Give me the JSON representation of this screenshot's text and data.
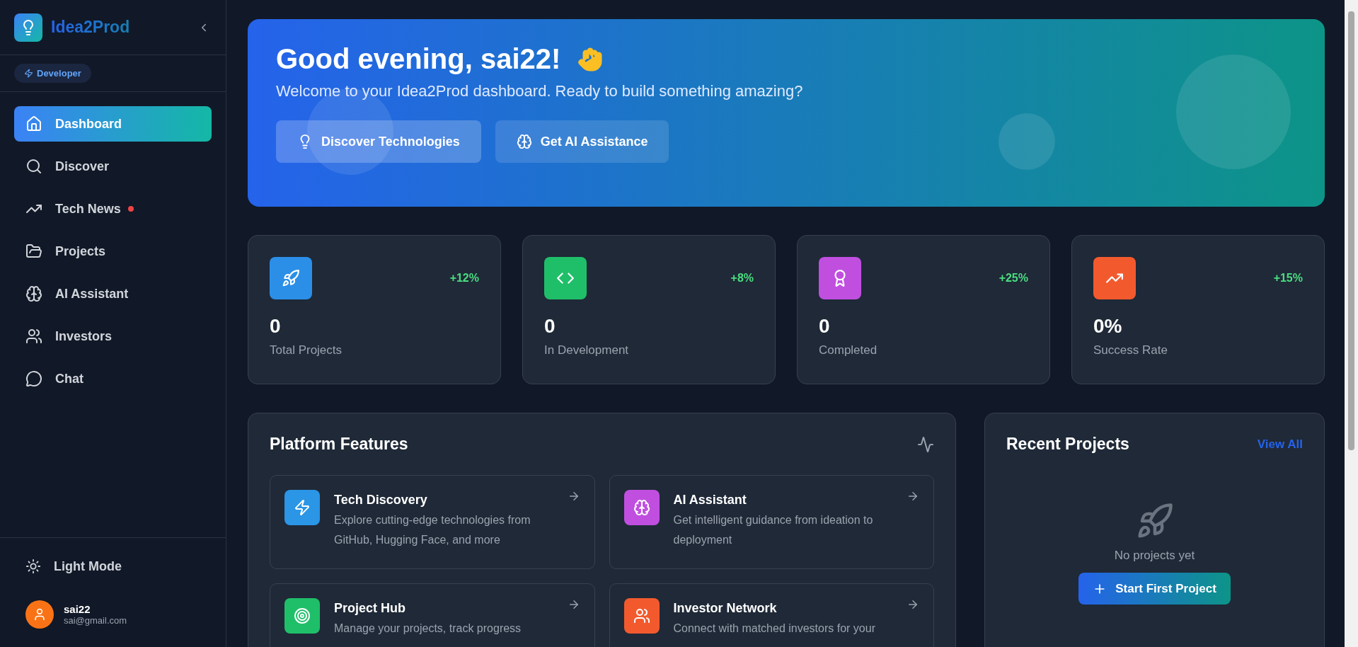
{
  "sidebar": {
    "logo": "Idea2Prod",
    "role_badge": "Developer",
    "items": [
      {
        "label": "Dashboard",
        "selected": true,
        "notification": false
      },
      {
        "label": "Discover",
        "selected": false,
        "notification": false
      },
      {
        "label": "Tech News",
        "selected": false,
        "notification": true
      },
      {
        "label": "Projects",
        "selected": false,
        "notification": false
      },
      {
        "label": "AI Assistant",
        "selected": false,
        "notification": false
      },
      {
        "label": "Investors",
        "selected": false,
        "notification": false
      },
      {
        "label": "Chat",
        "selected": false,
        "notification": false
      }
    ],
    "theme_toggle": "Light Mode",
    "user": {
      "name": "sai22",
      "email": "sai@gmail.com"
    }
  },
  "banner": {
    "greeting": "Good evening, sai22!",
    "subtitle": "Welcome to your Idea2Prod dashboard. Ready to build something amazing?",
    "buttons": [
      "Discover Technologies",
      "Get AI Assistance"
    ]
  },
  "stats": [
    {
      "value": "0",
      "label": "Total Projects",
      "change": "+12%",
      "color": "#2b8fe8"
    },
    {
      "value": "0",
      "label": "In Development",
      "change": "+8%",
      "color": "#1fbf6a"
    },
    {
      "value": "0",
      "label": "Completed",
      "change": "+25%",
      "color": "#c04fe0"
    },
    {
      "value": "0%",
      "label": "Success Rate",
      "change": "+15%",
      "color": "#f25a2e"
    }
  ],
  "features": {
    "title": "Platform Features",
    "cards": [
      {
        "title": "Tech Discovery",
        "description": "Explore cutting-edge technologies from GitHub, Hugging Face, and more",
        "color": "#2b95e6"
      },
      {
        "title": "AI Assistant",
        "description": "Get intelligent guidance from ideation to deployment",
        "color": "#c04fe0"
      },
      {
        "title": "Project Hub",
        "description": "Manage your projects, track progress",
        "color": "#1fbf6a"
      },
      {
        "title": "Investor Network",
        "description": "Connect with matched investors for your",
        "color": "#f25a2e"
      }
    ]
  },
  "recent_projects": {
    "title": "Recent Projects",
    "link": "View All",
    "empty_text": "No projects yet",
    "button": "Start First Project"
  }
}
